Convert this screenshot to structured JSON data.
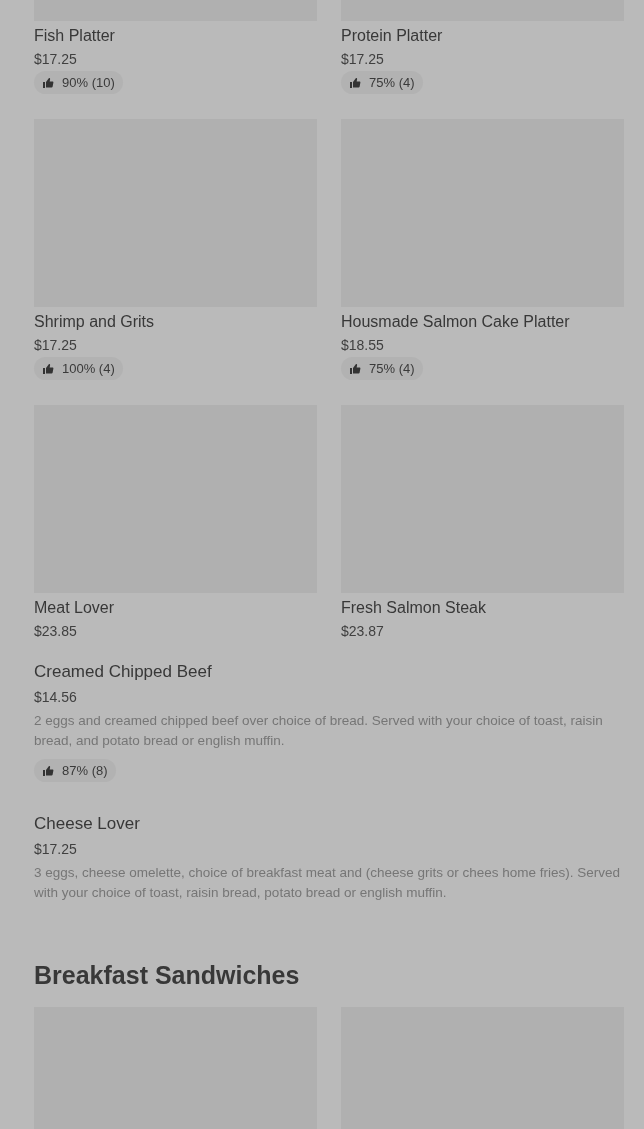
{
  "grid_items": [
    {
      "name": "Fish Platter",
      "price": "$17.25",
      "rating": "90% (10)"
    },
    {
      "name": "Protein Platter",
      "price": "$17.25",
      "rating": "75% (4)"
    },
    {
      "name": "Shrimp and Grits",
      "price": "$17.25",
      "rating": "100% (4)"
    },
    {
      "name": "Housmade Salmon Cake Platter",
      "price": "$18.55",
      "rating": "75% (4)"
    },
    {
      "name": "Meat Lover",
      "price": "$23.85"
    },
    {
      "name": "Fresh Salmon Steak",
      "price": "$23.87"
    }
  ],
  "list_items": [
    {
      "name": "Creamed Chipped Beef",
      "price": "$14.56",
      "description": "2 eggs and creamed chipped beef over choice of bread. Served with your choice of toast, raisin bread, and potato bread or english muffin.",
      "rating": "87% (8)"
    },
    {
      "name": "Cheese Lover",
      "price": "$17.25",
      "description": "3 eggs, cheese omelette, choice of breakfast meat and (cheese grits or chees home fries). Served with your choice of toast, raisin bread, potato bread or english muffin."
    }
  ],
  "section": {
    "title": "Breakfast Sandwiches"
  }
}
